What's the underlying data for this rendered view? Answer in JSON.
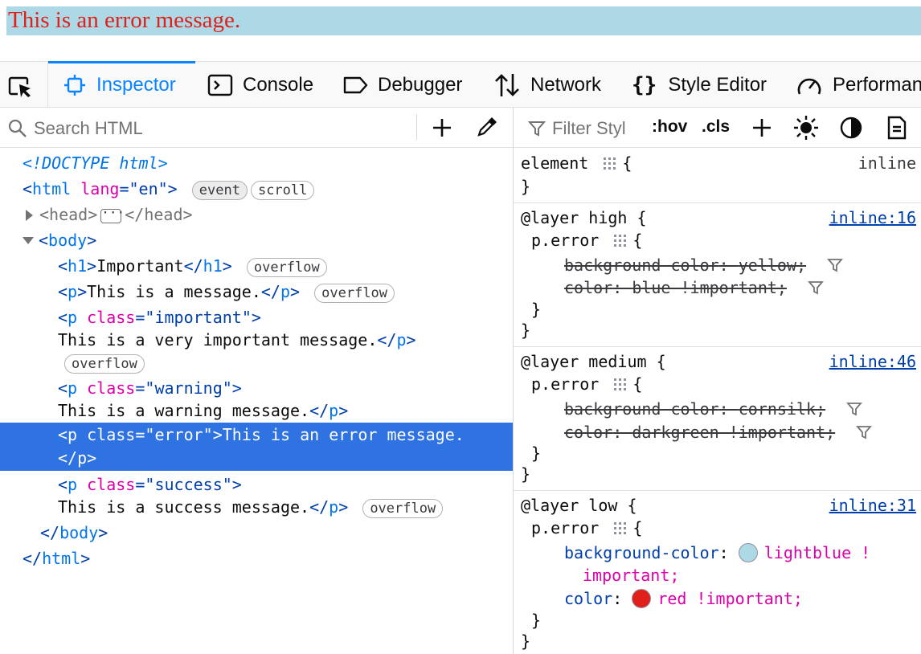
{
  "page": {
    "message": "This is an error message.",
    "message_bg": "#add8e6",
    "message_color": "#e0201b"
  },
  "toolbar": {
    "tabs": [
      {
        "label": "Inspector",
        "icon": "inspector-icon",
        "active": true
      },
      {
        "label": "Console",
        "icon": "console-icon"
      },
      {
        "label": "Debugger",
        "icon": "debugger-icon"
      },
      {
        "label": "Network",
        "icon": "network-icon"
      },
      {
        "label": "Style Editor",
        "icon": "braces-icon"
      },
      {
        "label": "Performan",
        "icon": "performance-icon"
      }
    ]
  },
  "html_panel": {
    "search_placeholder": "Search HTML",
    "doctype": "<!DOCTYPE html>",
    "html_lang": "en",
    "badges": {
      "event": "event",
      "scroll": "scroll",
      "overflow": "overflow"
    },
    "h1_text": "Important",
    "p_text": "This is a message.",
    "important_text": "This is a very important message.",
    "warning_text": "This is a warning message.",
    "error_text": "This is an error message.",
    "success_text": "This is a success message.",
    "classes": {
      "important": "important",
      "warning": "warning",
      "error": "error",
      "success": "success"
    }
  },
  "rules_panel": {
    "filter_placeholder": "Filter Styl",
    "hov": ":hov",
    "cls": ".cls",
    "element_rule": {
      "selector": "element",
      "source": "inline"
    },
    "layers": [
      {
        "header": "@layer high {",
        "source": "inline:16",
        "selector": "p.error",
        "decls": [
          {
            "prop": "background-color",
            "value": "yellow;"
          },
          {
            "prop": "color",
            "value": "blue !important;"
          }
        ]
      },
      {
        "header": "@layer medium {",
        "source": "inline:46",
        "selector": "p.error",
        "decls": [
          {
            "prop": "background-color",
            "value": "cornsilk;"
          },
          {
            "prop": "color",
            "value": "darkgreen !important;"
          }
        ]
      },
      {
        "header": "@layer low {",
        "source": "inline:31",
        "selector": "p.error",
        "decls": [
          {
            "prop": "background-color",
            "value": "lightblue !",
            "value2": "important;",
            "swatch": "#add8e6"
          },
          {
            "prop": "color",
            "value": "red !important;",
            "swatch": "#e0201b"
          }
        ]
      }
    ]
  }
}
